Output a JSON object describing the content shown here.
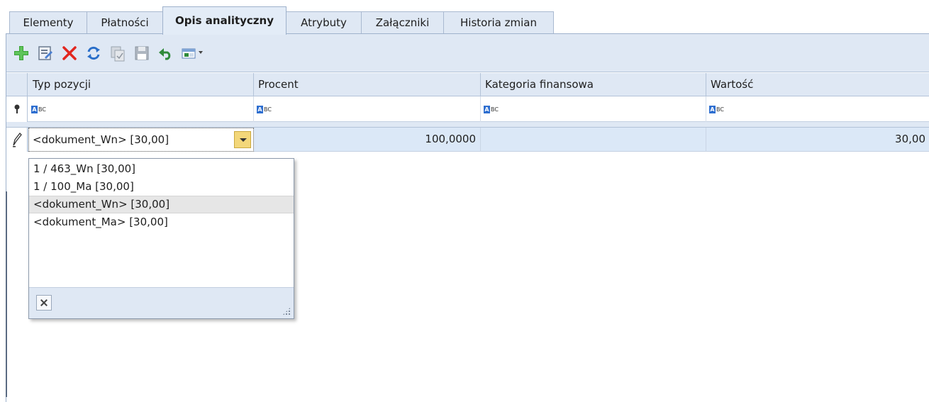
{
  "tabs": [
    {
      "label": "Elementy",
      "active": false
    },
    {
      "label": "Płatności",
      "active": false
    },
    {
      "label": "Opis analityczny",
      "active": true
    },
    {
      "label": "Atrybuty",
      "active": false
    },
    {
      "label": "Załączniki",
      "active": false
    },
    {
      "label": "Historia zmian",
      "active": false
    }
  ],
  "toolbar": {
    "icons": [
      "add-icon",
      "edit-icon",
      "delete-icon",
      "refresh-icon",
      "copy-icon",
      "save-icon",
      "undo-icon",
      "layout-dropdown-icon"
    ]
  },
  "grid": {
    "columns": [
      "Typ pozycji",
      "Procent",
      "Kategoria finansowa",
      "Wartość"
    ],
    "filter_placeholder": "BC",
    "filter_glyph": "A",
    "row": {
      "typ_pozycji": "<dokument_Wn> [30,00]",
      "procent": "100,0000",
      "kategoria": "",
      "wartosc": "30,00"
    }
  },
  "dropdown": {
    "items": [
      "1 / 463_Wn [30,00]",
      "1 / 100_Ma [30,00]",
      "<dokument_Wn> [30,00]",
      "<dokument_Ma> [30,00]"
    ],
    "selected_index": 2
  },
  "colors": {
    "accent": "#dfe8f4",
    "selected_row": "#dbe8f7",
    "delete": "#e2271f",
    "add": "#3aa335"
  }
}
